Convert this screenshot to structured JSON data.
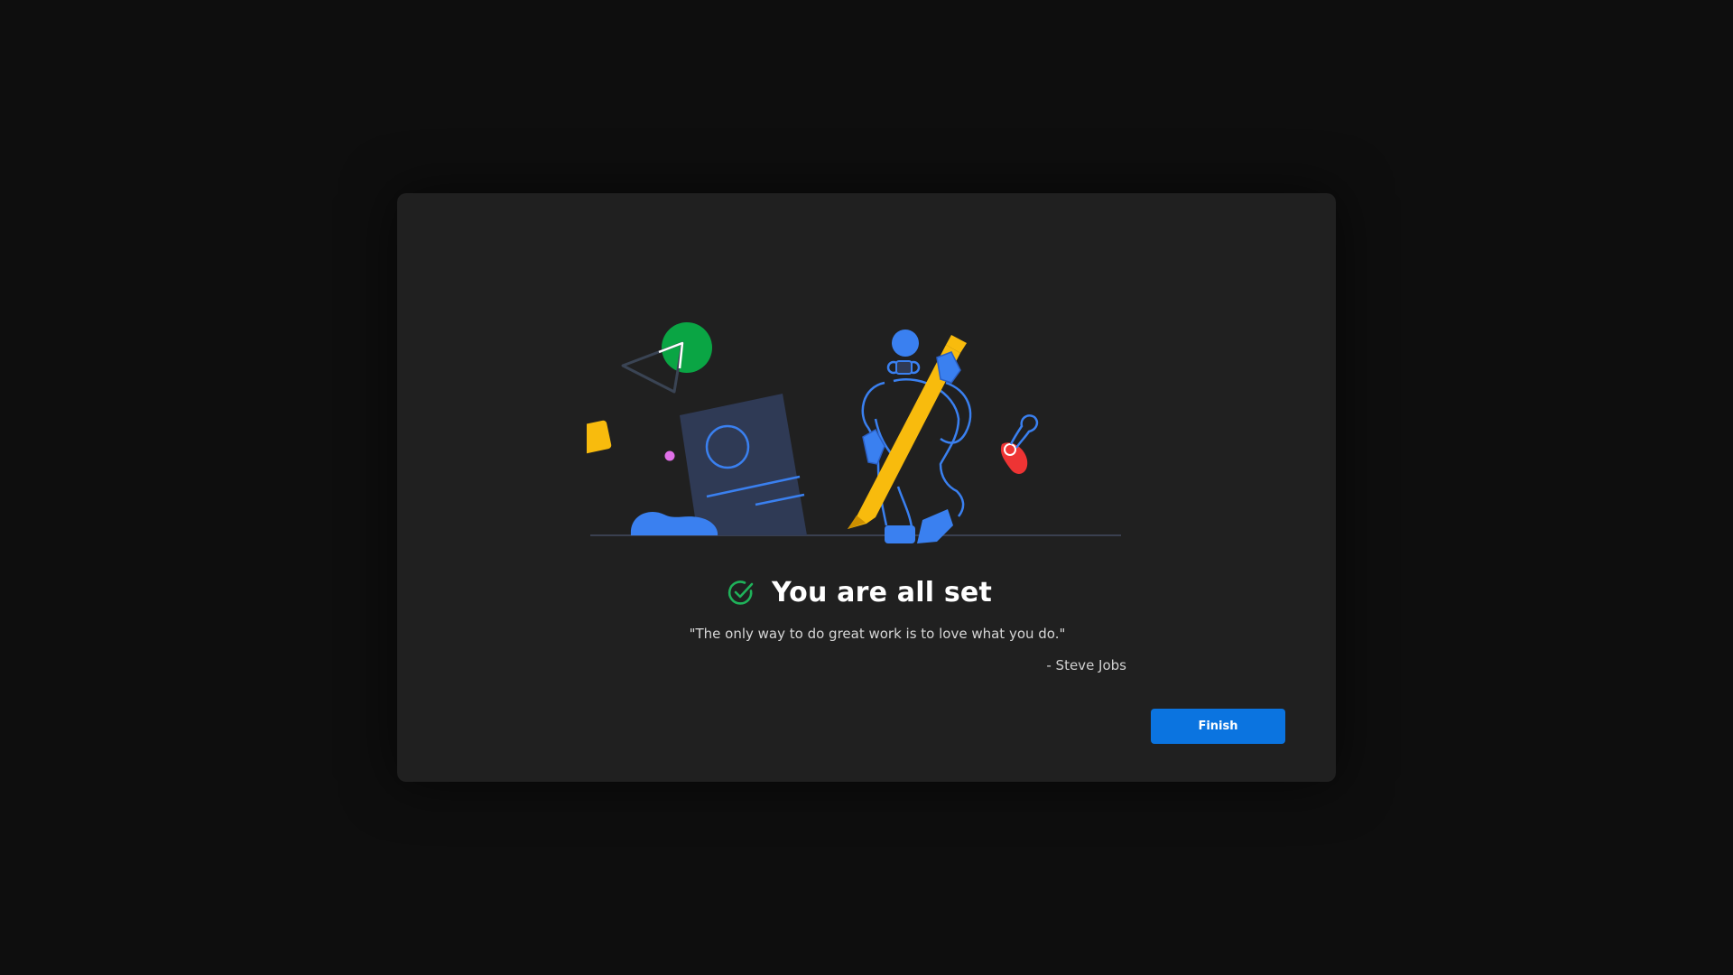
{
  "dialog": {
    "title": "You are all set",
    "quote": "\"The only way to do great work is to love what you do.\"",
    "author": "- Steve Jobs",
    "finish_label": "Finish"
  },
  "icons": {
    "title_icon": "check-circle-icon",
    "illustration": "person-with-pencil-illustration"
  },
  "colors": {
    "accent": "#0b74e0",
    "success": "#1fb25a",
    "dialog_bg": "#202020",
    "page_bg": "#0e0e0e",
    "illustration_blue": "#3a80f0",
    "illustration_yellow": "#f8bb0d",
    "illustration_green": "#0aa544",
    "illustration_red": "#ee3434"
  }
}
